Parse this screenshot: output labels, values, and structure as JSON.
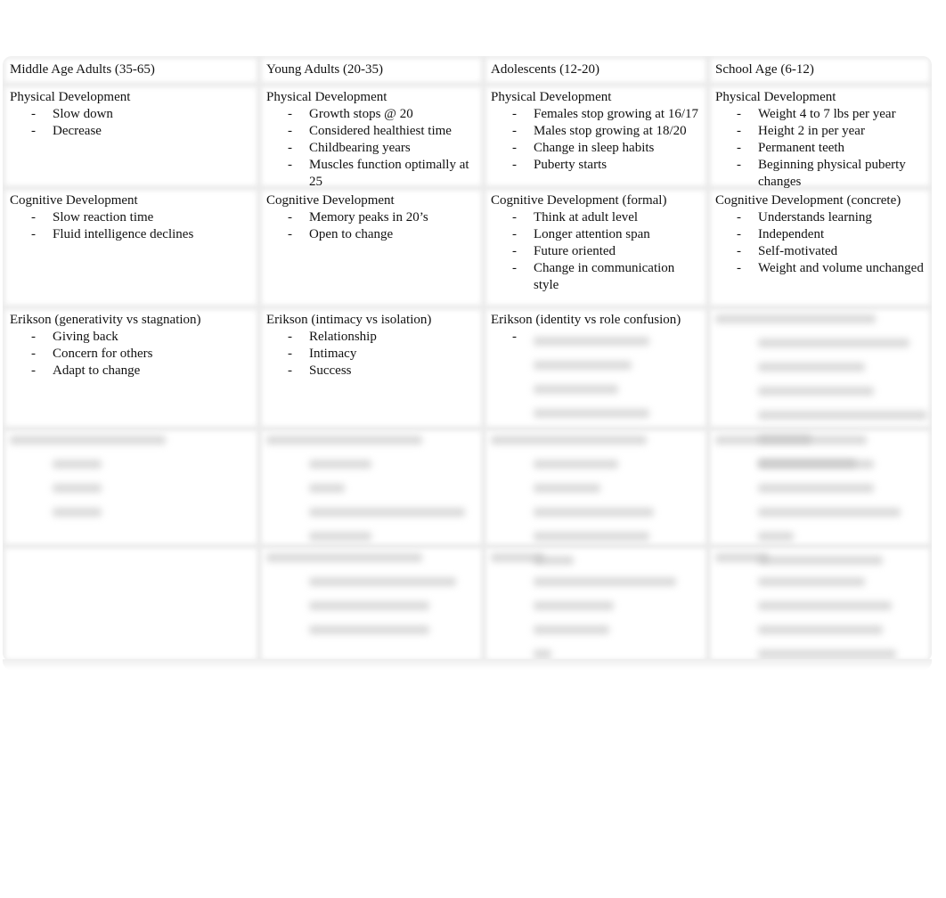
{
  "columns": [
    {
      "header": "Middle Age Adults (35-65)",
      "physical": {
        "title": "Physical Development",
        "items": [
          "Slow down",
          "Decrease"
        ]
      },
      "cognitive": {
        "title": "Cognitive Development",
        "items": [
          "Slow reaction time",
          "Fluid intelligence declines"
        ]
      },
      "erikson": {
        "title": "Erikson (generativity vs stagnation)",
        "items": [
          "Giving back",
          "Concern for others",
          "Adapt to change"
        ]
      }
    },
    {
      "header": "Young Adults (20-35)",
      "physical": {
        "title": "Physical Development",
        "items": [
          "Growth stops @ 20",
          "Considered healthiest time",
          "Childbearing years",
          "Muscles function optimally at 25"
        ]
      },
      "cognitive": {
        "title": "Cognitive Development",
        "items": [
          "Memory peaks in 20’s",
          "Open to change"
        ]
      },
      "erikson": {
        "title": "Erikson (intimacy vs isolation)",
        "items": [
          "Relationship",
          "Intimacy",
          "Success"
        ]
      }
    },
    {
      "header": "Adolescents (12-20)",
      "physical": {
        "title": "Physical Development",
        "items": [
          "Females stop growing at 16/17",
          "Males stop growing at 18/20",
          "Change in sleep habits",
          "Puberty starts"
        ]
      },
      "cognitive": {
        "title": "Cognitive Development (formal)",
        "items": [
          "Think at adult level",
          "Longer attention span",
          "Future oriented",
          "Change in communication style"
        ]
      },
      "erikson": {
        "title": "Erikson (identity vs role confusion)",
        "items": [
          ""
        ]
      }
    },
    {
      "header": "School Age (6-12)",
      "physical": {
        "title": "Physical Development",
        "items": [
          "Weight 4 to 7 lbs per year",
          "Height 2 in per year",
          "Permanent teeth",
          "Beginning physical puberty changes"
        ]
      },
      "cognitive": {
        "title": "Cognitive Development (concrete)",
        "items": [
          "Understands learning",
          "Independent",
          "Self-motivated",
          "Weight and volume unchanged"
        ]
      }
    }
  ],
  "dash": "-"
}
